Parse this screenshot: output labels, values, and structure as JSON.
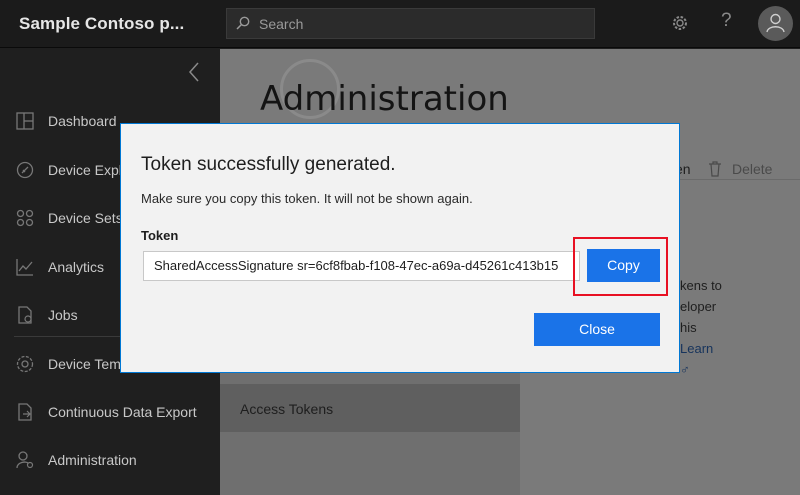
{
  "header": {
    "app_title": "Sample Contoso p...",
    "search_placeholder": "Search",
    "help_label": "?"
  },
  "sidebar": {
    "items": [
      {
        "label": "Dashboard",
        "icon": "dashboard-icon"
      },
      {
        "label": "Device Explo",
        "icon": "device-explorer-icon"
      },
      {
        "label": "Device Sets",
        "icon": "device-sets-icon"
      },
      {
        "label": "Analytics",
        "icon": "analytics-icon"
      },
      {
        "label": "Jobs",
        "icon": "jobs-icon"
      },
      {
        "label": "Device Tem",
        "icon": "device-templates-icon"
      },
      {
        "label": "Continuous Data Export",
        "icon": "data-export-icon"
      },
      {
        "label": "Administration",
        "icon": "administration-icon"
      }
    ]
  },
  "main": {
    "page_title": "Administration",
    "submenu_active": "Access Tokens",
    "toolbar_edit": "en",
    "toolbar_delete": "Delete",
    "hint_lines": [
      "kens to",
      "eloper",
      "his",
      "Learn",
      "♂"
    ]
  },
  "dialog": {
    "title": "Token successfully generated.",
    "message": "Make sure you copy this token. It will not be shown again.",
    "token_label": "Token",
    "token_value": "SharedAccessSignature sr=6cf8fbab-f108-47ec-a69a-d45261c413b15",
    "copy_label": "Copy",
    "close_label": "Close"
  },
  "colors": {
    "accent": "#1a73e8",
    "highlight": "#e81123",
    "dialog_border": "#0078d4"
  }
}
